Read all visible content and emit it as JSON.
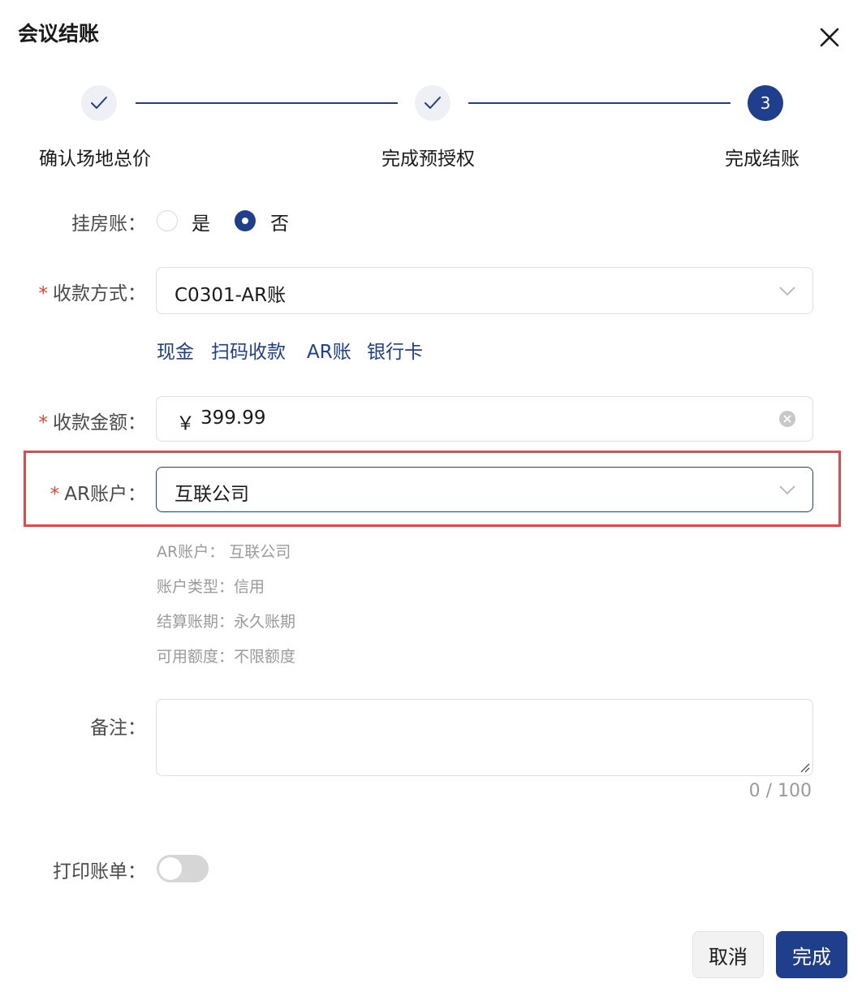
{
  "dialog": {
    "title": "会议结账"
  },
  "steps": [
    {
      "label": "确认场地总价",
      "status": "done"
    },
    {
      "label": "完成预授权",
      "status": "done"
    },
    {
      "label": "完成结账",
      "status": "active",
      "number": "3"
    }
  ],
  "form": {
    "hang_room": {
      "label": "挂房账：",
      "options": [
        "是",
        "否"
      ],
      "selected": "否"
    },
    "payment_method": {
      "label": "收款方式：",
      "required": "*",
      "value": "C0301-AR账",
      "quick_options": [
        "现金",
        "扫码收款",
        "AR账",
        "银行卡"
      ]
    },
    "amount": {
      "label": "收款金额：",
      "required": "*",
      "currency": "￥",
      "value": "399.99"
    },
    "ar_account": {
      "label": "AR账户：",
      "required": "*",
      "value": "互联公司",
      "details": [
        "AR账户：  互联公司",
        "账户类型：信用",
        "结算账期：永久账期",
        "可用额度：不限额度"
      ]
    },
    "remark": {
      "label": "备注：",
      "value": "",
      "counter": "0 / 100"
    },
    "print_bill": {
      "label": "打印账单：",
      "enabled": false
    }
  },
  "footer": {
    "cancel_label": "取消",
    "confirm_label": "完成"
  },
  "colors": {
    "primary": "#1f3e8c",
    "highlight_border": "#e8474a",
    "required": "#e0452f"
  }
}
